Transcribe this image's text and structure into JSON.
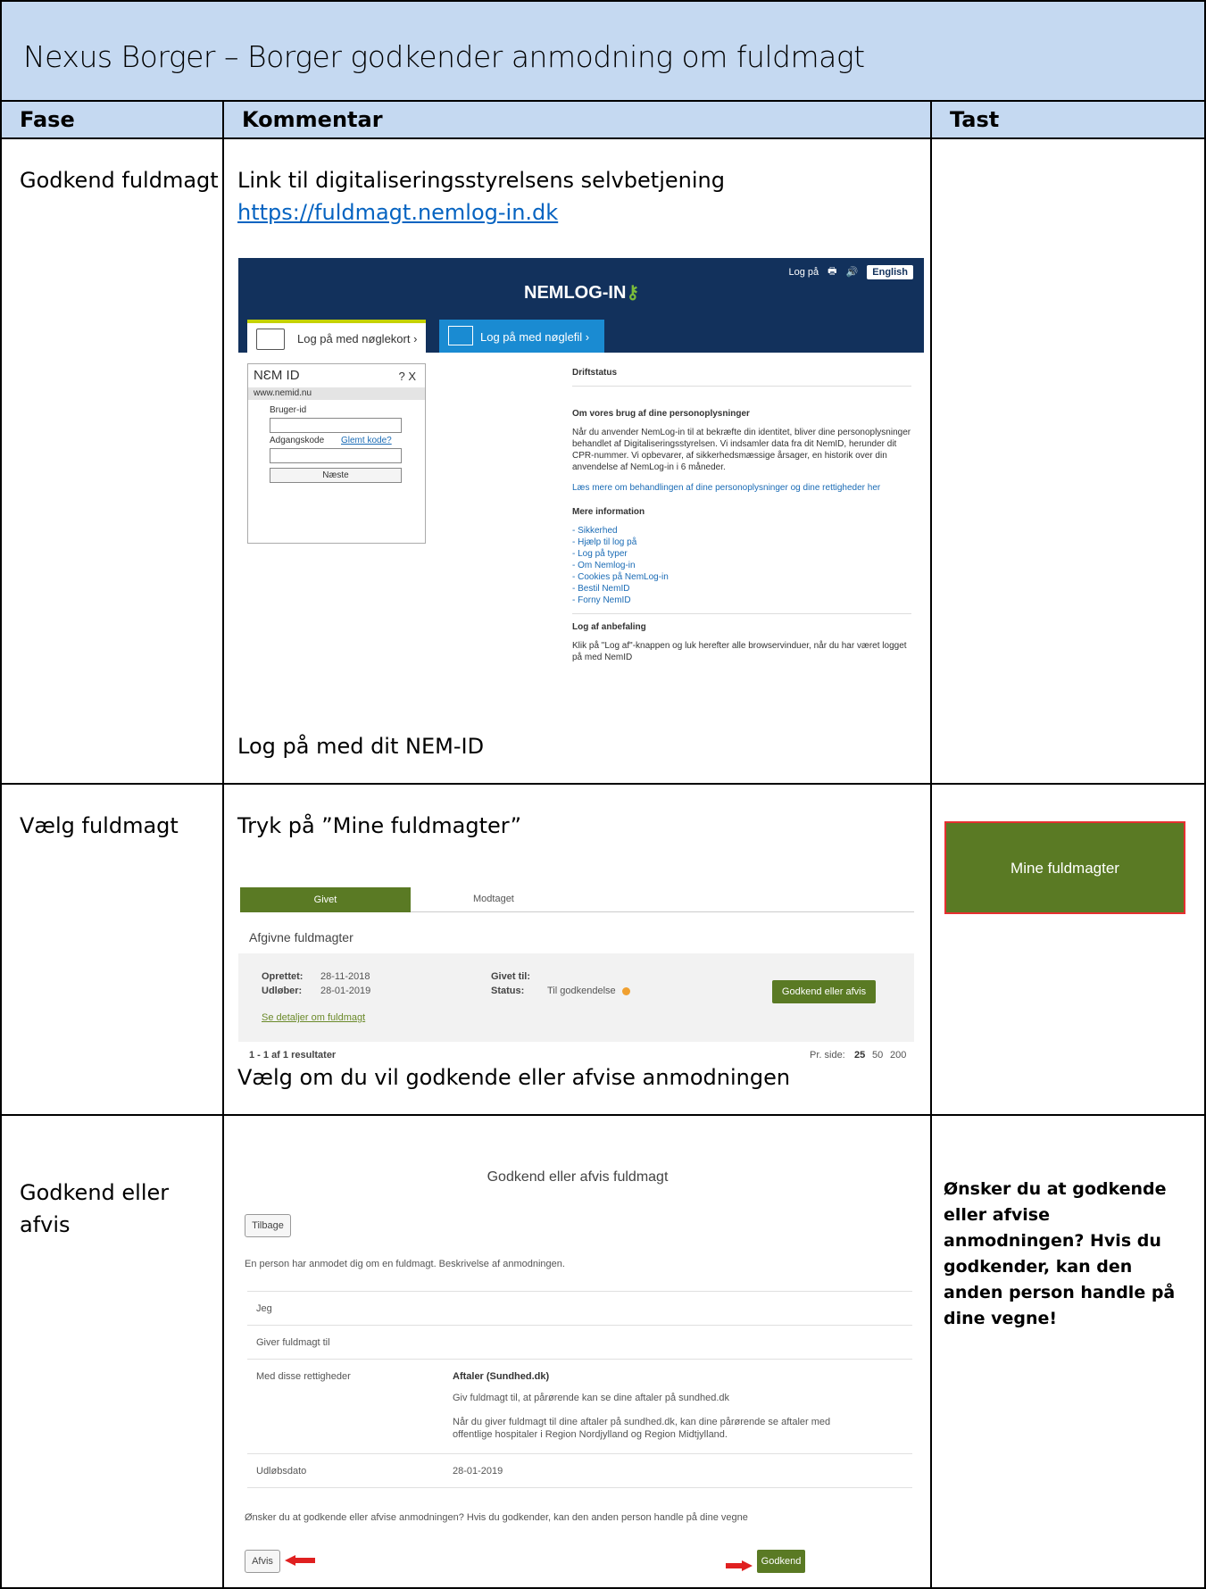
{
  "title": "Nexus Borger – Borger godkender anmodning om fuldmagt",
  "headers": {
    "fase": "Fase",
    "kommentar": "Kommentar",
    "tast": "Tast"
  },
  "rows": [
    {
      "fase": "Godkend fuldmagt",
      "comment1": "Link til digitaliseringsstyrelsens selvbetjening",
      "link": "https://fuldmagt.nemlog-in.dk",
      "comment2": "Log på med dit NEM-ID"
    },
    {
      "fase": "Vælg fuldmagt",
      "comment1": "Tryk på ”Mine fuldmagter”",
      "comment2": "Vælg om du vil godkende eller afvise anmodningen",
      "tast_button": "Mine fuldmagter"
    },
    {
      "fase": "Godkend eller afvis",
      "tast_text": "Ønsker du at godkende eller afvise anmodningen? Hvis du godkender, kan den anden person handle på dine vegne!"
    }
  ],
  "nemlogin": {
    "logo": "NEMLOG-IN",
    "top_links": [
      "Log på",
      "🖶",
      "🔊"
    ],
    "english": "English",
    "tab_noglekort": "Log på med nøglekort ›",
    "tab_noglefil": "Log på med nøglefil ›",
    "nemid_title": "NƐM ID",
    "nemid_help": "?  X",
    "nemid_url": "www.nemid.nu",
    "bruger_id": "Bruger-id",
    "adgangskode": "Adgangskode",
    "glemt": "Glemt kode?",
    "naeste": "Næste",
    "driftstatus": "Driftstatus",
    "personopl_heading": "Om vores brug af dine personoplysninger",
    "personopl_text": "Når du anvender NemLog-in til at bekræfte din identitet, bliver dine personoplysninger behandlet af Digitaliseringsstyrelsen. Vi indsamler data fra dit NemID, herunder dit CPR-nummer. Vi opbevarer, af sikkerhedsmæssige årsager, en historik over din anvendelse af NemLog-in i 6 måneder.",
    "personopl_link": "Læs mere om behandlingen af dine personoplysninger og dine rettigheder her",
    "mere_info": "Mere information",
    "links": [
      "- Sikkerhed",
      "- Hjælp til log på",
      "- Log på typer",
      "- Om Nemlog-in",
      "- Cookies på NemLog-in",
      "- Bestil NemID",
      "- Forny NemID"
    ],
    "logaf_heading": "Log af anbefaling",
    "logaf_text": "Klik på \"Log af\"-knappen og luk herefter alle browservinduer, når du har været logget på med NemID"
  },
  "fuldmagt": {
    "tab_givet": "Givet",
    "tab_modtaget": "Modtaget",
    "heading": "Afgivne fuldmagter",
    "oprettet_label": "Oprettet:",
    "oprettet": "28-11-2018",
    "udlober_label": "Udløber:",
    "udlober": "28-01-2019",
    "givet_til_label": "Givet til:",
    "status_label": "Status:",
    "status": "Til godkendelse",
    "btn": "Godkend eller afvis",
    "details_link": "Se detaljer om fuldmagt",
    "results": "1 - 1 af 1 resultater",
    "pr_side": "Pr. side:",
    "pages": [
      "25",
      "50",
      "200"
    ]
  },
  "godkend": {
    "heading": "Godkend eller afvis fuldmagt",
    "tilbage": "Tilbage",
    "desc": "En person har anmodet dig om en fuldmagt. Beskrivelse af anmodningen.",
    "jeg": "Jeg",
    "giver": "Giver fuldmagt til",
    "rettigheder_label": "Med disse rettigheder",
    "rettighed_title": "Aftaler (Sundhed.dk)",
    "rettighed_1": "Giv fuldmagt til, at pårørende kan se dine aftaler på sundhed.dk",
    "rettighed_2": "Når du giver fuldmagt til dine aftaler på sundhed.dk, kan dine pårørende se aftaler med offentlige hospitaler i Region Nordjylland og Region Midtjylland.",
    "udlobsdato_label": "Udløbsdato",
    "udlobsdato": "28-01-2019",
    "question": "Ønsker du at godkende eller afvise anmodningen? Hvis du godkender, kan den anden person handle på dine vegne",
    "afvis": "Afvis",
    "godkend": "Godkend"
  }
}
